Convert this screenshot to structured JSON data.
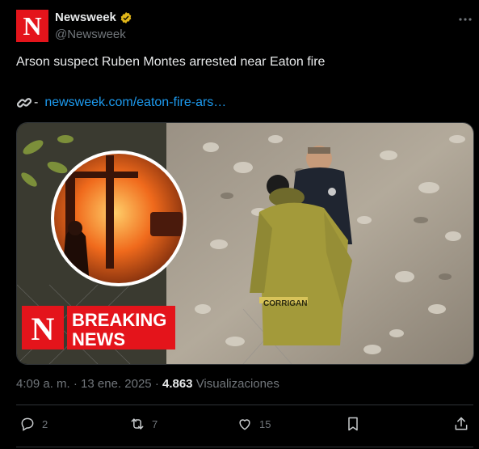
{
  "author": {
    "avatar_letter": "N",
    "name": "Newsweek",
    "handle": "@Newsweek",
    "verified_icon": "verified-badge-icon",
    "brand_color": "#e4141b"
  },
  "tweet": {
    "text": "Arson suspect Ruben Montes arrested near Eaton fire",
    "link_dash": "-",
    "link_url": "newsweek.com/eaton-fire-ars…"
  },
  "media": {
    "badge_letter": "N",
    "breaking_line1": "BREAKING",
    "breaking_line2": "NEWS",
    "jacket_text": "CORRIGAN"
  },
  "meta": {
    "time": "4:09 a. m.",
    "separator": "·",
    "date": "13 ene. 2025",
    "views_count": "4.863",
    "views_label": "Visualizaciones"
  },
  "actions": {
    "replies": "2",
    "reposts": "7",
    "likes": "15"
  },
  "colors": {
    "background": "#000000",
    "text": "#e7e9ea",
    "muted": "#71767b",
    "link": "#1d9bf0",
    "divider": "#2f3336"
  }
}
